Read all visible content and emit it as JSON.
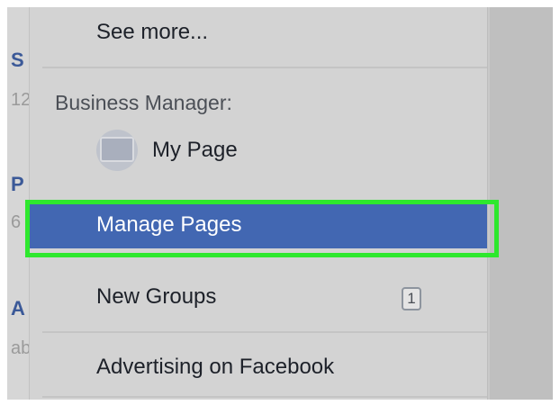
{
  "background_sidebar": {
    "items": [
      {
        "initial": "S",
        "subtext": "12"
      },
      {
        "initial": "P",
        "subtext": "6"
      },
      {
        "initial": "A",
        "subtext": "ab"
      }
    ]
  },
  "menu": {
    "see_more": "See more...",
    "business_manager_header": "Business Manager:",
    "pages": [
      {
        "label": "My Page",
        "avatar_icon": "page-avatar"
      }
    ],
    "manage_pages": "Manage Pages",
    "new_groups": "New Groups",
    "new_groups_count": "1",
    "advertising": "Advertising on Facebook"
  },
  "colors": {
    "highlight_bg": "#4267b2",
    "annotation_box": "#2ee82e",
    "link_blue": "#3b5998"
  }
}
